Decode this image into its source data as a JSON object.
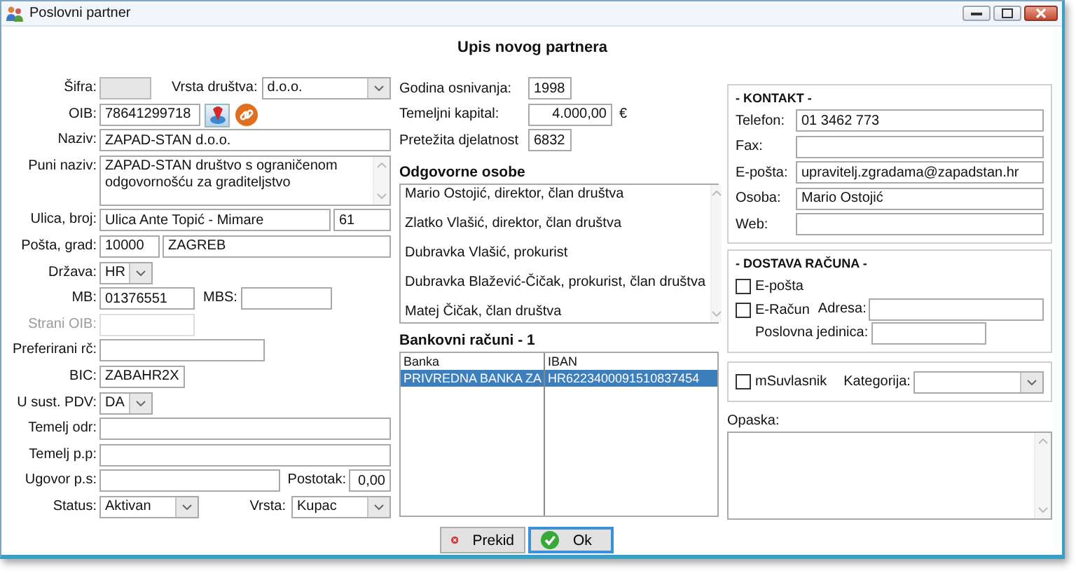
{
  "window": {
    "title": "Poslovni partner"
  },
  "heading": "Upis novog partnera",
  "left": {
    "sifra": {
      "label": "Šifra:",
      "disabled": true
    },
    "vrsta_drustva": {
      "label": "Vrsta društva:",
      "value": "d.o.o."
    },
    "oib": {
      "label": "OIB:",
      "value": "78641299718"
    },
    "naziv": {
      "label": "Naziv:",
      "value": "ZAPAD-STAN d.o.o."
    },
    "puni_naziv": {
      "label": "Puni naziv:",
      "value": "ZAPAD-STAN društvo s ograničenom odgovornošću za graditeljstvo"
    },
    "ulica_broj": {
      "label": "Ulica, broj:",
      "street": "Ulica Ante Topić - Mimare",
      "number": "61"
    },
    "posta_grad": {
      "label": "Pošta, grad:",
      "postcode": "10000",
      "city": "ZAGREB"
    },
    "drzava": {
      "label": "Država:",
      "value": "HR"
    },
    "mb": {
      "label": "MB:",
      "value": "01376551"
    },
    "mbs": {
      "label": "MBS:"
    },
    "strani_oib": {
      "label": "Strani OIB:",
      "disabled": true
    },
    "preferirani_rc": {
      "label": "Preferirani rč:"
    },
    "bic": {
      "label": "BIC:",
      "value": "ZABAHR2X"
    },
    "u_sust_pdv": {
      "label": "U sust. PDV:",
      "value": "DA"
    },
    "temelj_odr": {
      "label": "Temelj odr:"
    },
    "temelj_pp": {
      "label": "Temelj p.p:"
    },
    "ugovor_ps": {
      "label": "Ugovor p.s:"
    },
    "postotak": {
      "label": "Postotak:",
      "value": "0,00"
    },
    "status": {
      "label": "Status:",
      "value": "Aktivan"
    },
    "vrsta": {
      "label": "Vrsta:",
      "value": "Kupac"
    }
  },
  "middle": {
    "godina": {
      "label": "Godina osnivanja:",
      "value": "1998"
    },
    "kapital": {
      "label": "Temeljni kapital:",
      "value": "4.000,00",
      "currency": "€"
    },
    "djelatnost": {
      "label": "Pretežita djelatnost",
      "value": "6832"
    },
    "odgovorne_osobe": {
      "title": "Odgovorne osobe",
      "items": [
        "Mario Ostojić, direktor, član društva",
        "Zlatko Vlašić, direktor, član društva",
        "Dubravka Vlašić, prokurist",
        "Dubravka Blažević-Čičak, prokurist, član društva",
        "Matej Čičak, član društva"
      ]
    },
    "bankovni_racuni": {
      "title": "Bankovni računi - 1",
      "columns": [
        "Banka",
        "IBAN"
      ],
      "rows": [
        {
          "cells": [
            "PRIVREDNA BANKA ZA",
            "HR6223400091510837454"
          ],
          "selected": true
        }
      ]
    }
  },
  "right": {
    "kontakt": {
      "title": "- KONTAKT -",
      "fields": [
        {
          "label": "Telefon:",
          "value": "01 3462 773"
        },
        {
          "label": "Fax:"
        },
        {
          "label": "E-pošta:",
          "value": "upravitelj.zgradama@zapadstan.hr"
        },
        {
          "label": "Osoba:",
          "value": "Mario Ostojić"
        },
        {
          "label": "Web:"
        }
      ]
    },
    "dostava": {
      "title": "- DOSTAVA RAČUNA -",
      "checkboxes": [
        {
          "label": "E-pošta",
          "checked": false
        },
        {
          "label": "E-Račun",
          "checked": false
        }
      ],
      "adresa_label": "Adresa:",
      "poslovna_jedinica_label": "Poslovna jedinica:"
    },
    "msuvlasnik": {
      "label": "mSuvlasnik",
      "checked": false
    },
    "kategorija": {
      "label": "Kategorija:"
    },
    "opaska": {
      "label": "Opaska:"
    }
  },
  "buttons": [
    {
      "label": "Prekid",
      "kind": "cancel",
      "default": false
    },
    {
      "label": "Ok",
      "kind": "ok",
      "default": true
    }
  ]
}
